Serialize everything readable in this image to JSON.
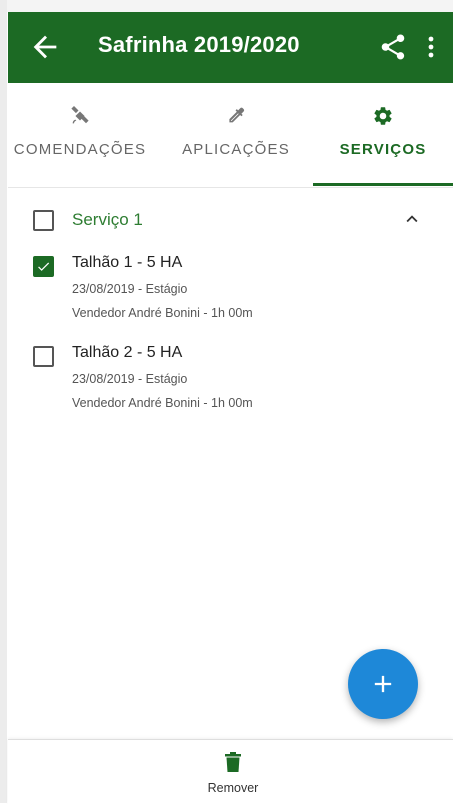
{
  "appbar": {
    "title": "Safrinha 2019/2020",
    "back_icon": "arrow-left-icon",
    "share_icon": "share-icon",
    "more_icon": "more-vertical-icon",
    "color": "#1c6a24"
  },
  "tabs": [
    {
      "label": "COMENDAÇÕES",
      "icon": "satellite-icon",
      "active": false
    },
    {
      "label": "APLICAÇÕES",
      "icon": "dropper-icon",
      "active": false
    },
    {
      "label": "SERVIÇOS",
      "icon": "gear-icon",
      "active": true
    }
  ],
  "service_group": {
    "title": "Serviço 1",
    "checked": false,
    "expanded": true,
    "items": [
      {
        "name": "Talhão 1 - 5 HA",
        "line2": "23/08/2019 - Estágio",
        "line3": "Vendedor André Bonini - 1h 00m",
        "checked": true
      },
      {
        "name": "Talhão 2 - 5 HA",
        "line2": "23/08/2019 - Estágio",
        "line3": "Vendedor André Bonini - 1h 00m",
        "checked": false
      }
    ]
  },
  "fab": {
    "icon": "plus-icon",
    "color": "#1e88d8"
  },
  "bottom_bar": {
    "remove_label": "Remover",
    "remove_icon": "trash-icon"
  }
}
